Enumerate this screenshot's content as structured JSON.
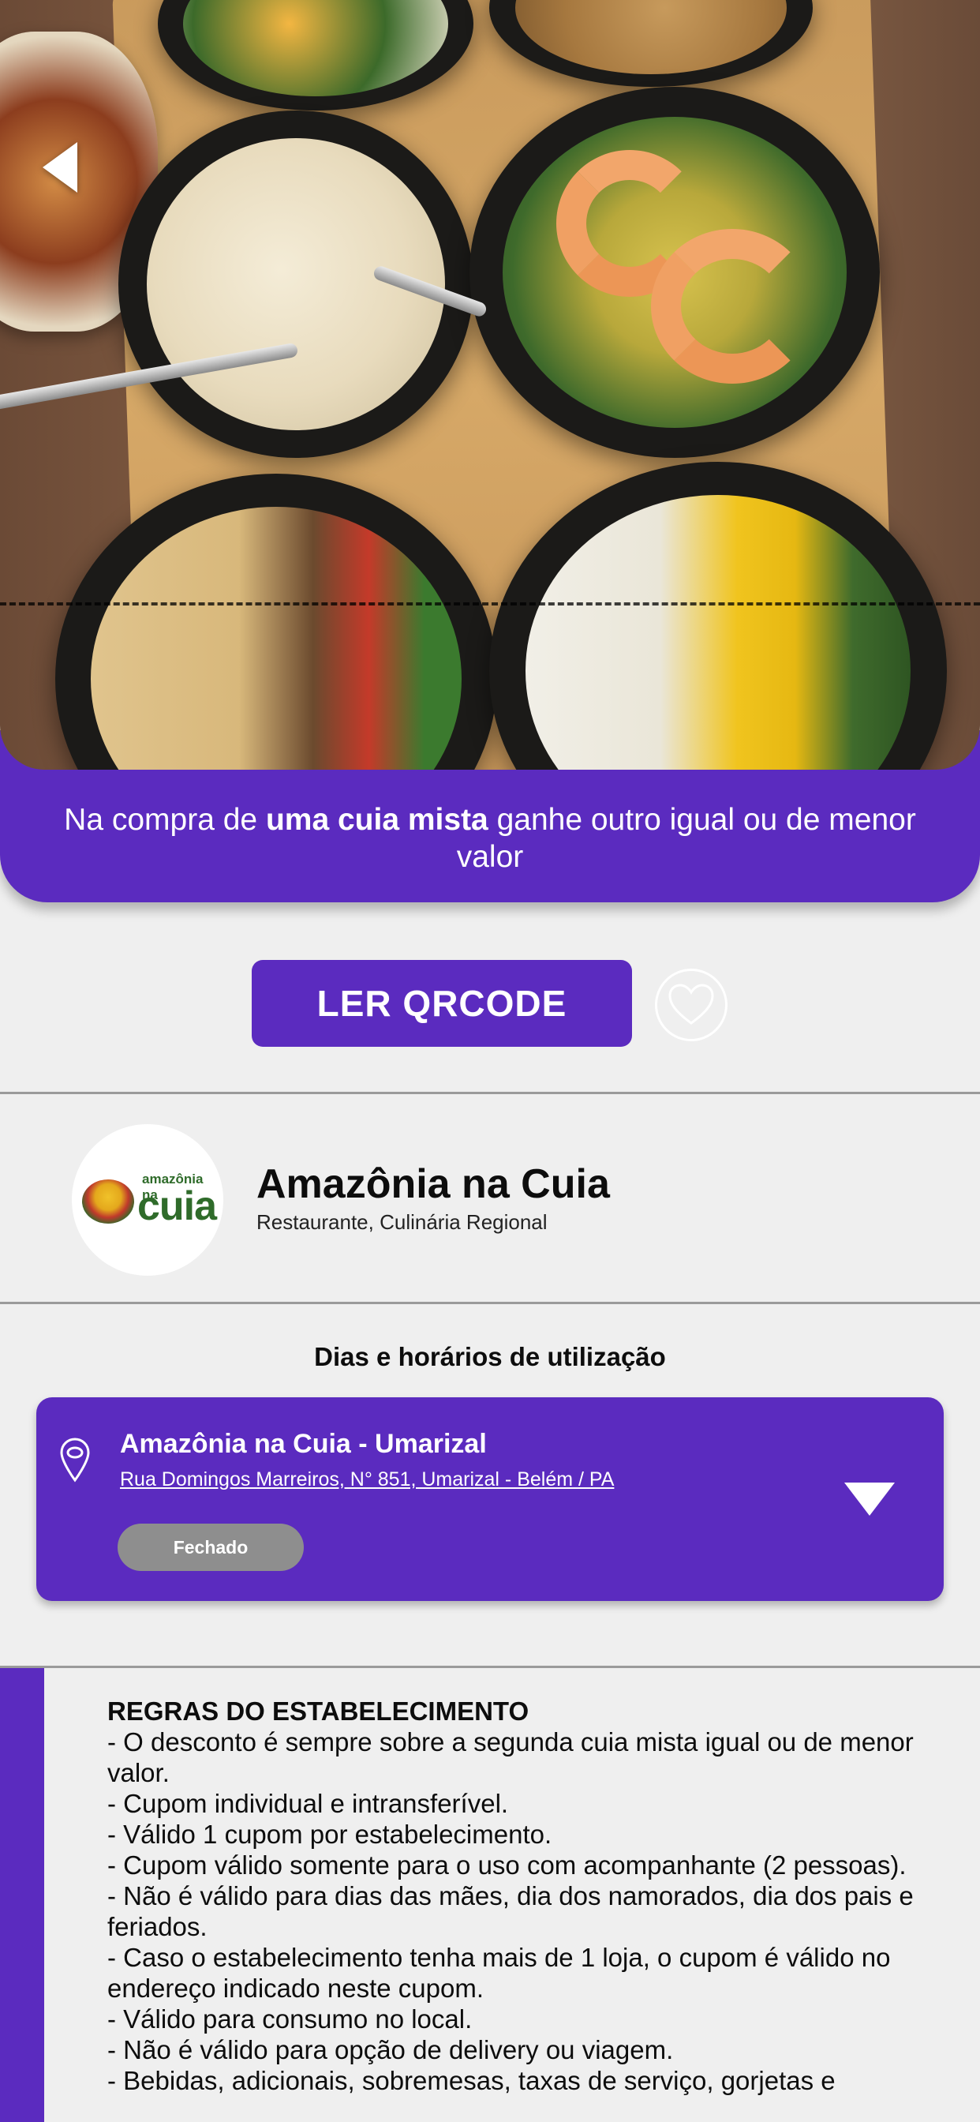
{
  "header": {
    "back_icon": "back-arrow-icon"
  },
  "promo": {
    "prefix": "Na compra de ",
    "highlight": "uma cuia mista",
    "suffix": " ganhe outro igual ou de menor valor"
  },
  "actions": {
    "qr_label": "LER QRCODE",
    "favorite_icon": "heart-icon"
  },
  "establishment": {
    "logo_small": "amazônia na",
    "logo_big": "cuia",
    "name": "Amazônia na Cuia",
    "category": "Restaurante, Culinária Regional"
  },
  "schedule": {
    "title": "Dias e horários de utilização",
    "location_name": "Amazônia na Cuia - Umarizal",
    "address": "Rua Domingos Marreiros, N° 851, Umarizal - Belém / PA",
    "status": "Fechado",
    "pin_icon": "location-pin-icon",
    "expand_icon": "chevron-down-icon"
  },
  "rules": {
    "title": "REGRAS DO ESTABELECIMENTO",
    "lines": [
      "- O desconto é sempre sobre a segunda cuia mista igual ou de menor valor.",
      "- Cupom individual e intransferível.",
      "- Válido 1 cupom por estabelecimento.",
      "- Cupom válido somente para o uso com acompanhante (2 pessoas).",
      "- Não é válido para dias das mães, dia dos namorados, dia dos pais e feriados.",
      "- Caso o estabelecimento tenha mais de 1 loja, o cupom é válido no endereço indicado neste cupom.",
      "- Válido para consumo no local.",
      "- Não é válido para opção de delivery ou viagem.",
      "- Bebidas, adicionais, sobremesas, taxas de serviço, gorjetas e"
    ]
  },
  "colors": {
    "primary": "#5b2bbf",
    "background": "#efefef",
    "status_closed": "#8e8e8e"
  }
}
